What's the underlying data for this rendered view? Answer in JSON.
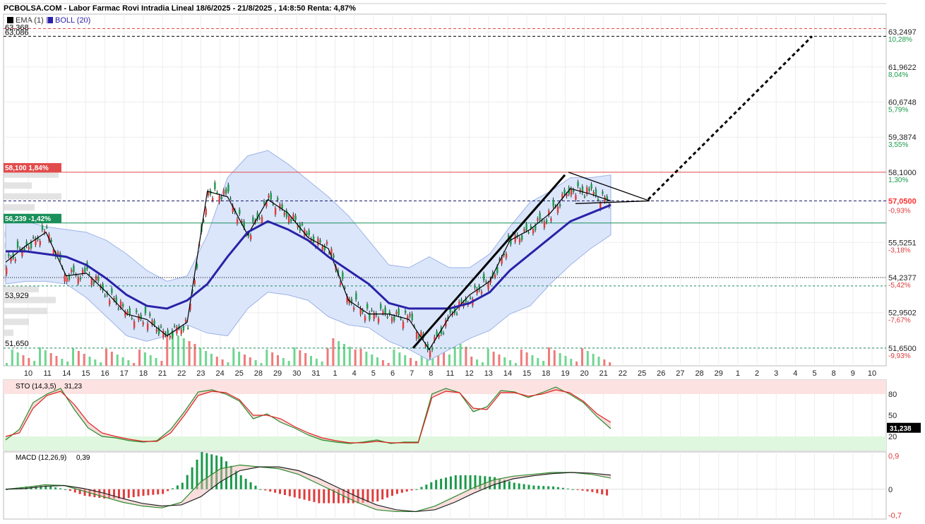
{
  "header": {
    "title": "PCBOLSA.COM - Labor Farmac Rovi Intradia Lineal 18/6/2025 - 21/8/2025 , 14:8:50 Renta: 4,87%",
    "ema_label": "EMA (1)",
    "boll_label": "BOLL (20)"
  },
  "colors": {
    "up": "#1a9a4a",
    "down": "#e03c3c",
    "boll_mid": "#2a22a8",
    "boll_band": "#dbe6fb",
    "boll_band_stroke": "#9db3e6",
    "resistance": "#e24b4b",
    "support": "#1a8f5a",
    "price_tag": "#ff4d4d",
    "volume_up": "#6fd690",
    "volume_down": "#f07a7a",
    "sto_k": "#e02020",
    "sto_d": "#2a8a2a",
    "macd_line": "#222222",
    "macd_signal": "#2a8a2a"
  },
  "chart_data": [
    {
      "type": "line",
      "title": "Labor Farmac Rovi Intradia Lineal 18/6/2025 - 21/8/2025",
      "x": [
        "10",
        "11",
        "14",
        "15",
        "16",
        "17",
        "18",
        "21",
        "22",
        "23",
        "24",
        "25",
        "28",
        "29",
        "30",
        "31",
        "1",
        "4",
        "5",
        "6",
        "7",
        "8",
        "11",
        "12",
        "13",
        "14",
        "15",
        "18",
        "19",
        "20",
        "21",
        "22",
        "25",
        "26",
        "27",
        "28",
        "29",
        "1",
        "2",
        "3",
        "4",
        "5",
        "8",
        "9",
        "10"
      ],
      "series": [
        {
          "name": "EMA (1)",
          "values": [
            54.8,
            55.4,
            55.9,
            54.3,
            54.4,
            53.7,
            52.9,
            52.7,
            52.1,
            52.6,
            57.4,
            57.2,
            55.8,
            57.1,
            56.6,
            55.7,
            55.3,
            53.4,
            52.9,
            52.9,
            52.7,
            51.6,
            52.8,
            53.6,
            54.1,
            55.6,
            56.0,
            56.6,
            57.5,
            57.3,
            57.05
          ]
        },
        {
          "name": "BOLL (20)",
          "values": [
            55.2,
            55.2,
            55.1,
            55.0,
            54.7,
            54.2,
            53.6,
            53.2,
            53.1,
            53.4,
            54.0,
            55.0,
            55.9,
            56.3,
            56.0,
            55.6,
            55.0,
            54.5,
            54.0,
            53.3,
            53.1,
            53.1,
            53.1,
            53.3,
            53.7,
            54.5,
            55.1,
            55.7,
            56.3,
            56.6,
            56.9
          ]
        }
      ],
      "y_ticks": [
        {
          "value": "63,2497",
          "pct": "10,28%"
        },
        {
          "value": "61,9622",
          "pct": "8,04%"
        },
        {
          "value": "60,6748",
          "pct": "5,79%"
        },
        {
          "value": "59,3874",
          "pct": "3,55%"
        },
        {
          "value": "58,1000",
          "pct": "1,30%"
        },
        {
          "value": "55,5251",
          "pct": "-3,18%"
        },
        {
          "value": "54,2377",
          "pct": "-5,42%"
        },
        {
          "value": "52,9502",
          "pct": "-7,67%"
        },
        {
          "value": "51,6500",
          "pct": "-9,93%"
        }
      ],
      "ylim": [
        51.0,
        63.9
      ],
      "last_price": "57,0500",
      "last_pct": "-0,93%",
      "levels": [
        {
          "name": "resistance",
          "value": 58.1,
          "label": "58,100  1,84%"
        },
        {
          "name": "support",
          "value": 56.239,
          "label": "56,239  -1,42%"
        },
        {
          "name": "top-dashed",
          "value": 63.086,
          "label": "63,086"
        },
        {
          "name": "top-max",
          "value": 63.368,
          "label": "63,368"
        },
        {
          "name": "low-dotted",
          "value": 53.929,
          "label": "53,929"
        },
        {
          "name": "min",
          "value": 51.65,
          "label": "51,650"
        }
      ],
      "grid": true
    },
    {
      "type": "line",
      "title": "STO (14,3,5)",
      "last_value": "31,23",
      "tag": "31,238",
      "y_ticks": [
        "80",
        "50",
        "20"
      ],
      "ylim": [
        0,
        100
      ],
      "series": [
        {
          "name": "K",
          "values": [
            15,
            30,
            68,
            80,
            88,
            58,
            32,
            20,
            18,
            14,
            12,
            14,
            30,
            55,
            83,
            86,
            80,
            70,
            45,
            52,
            40,
            32,
            22,
            15,
            12,
            10,
            12,
            15,
            10,
            12,
            12,
            80,
            88,
            82,
            55,
            62,
            85,
            83,
            75,
            82,
            90,
            80,
            68,
            48,
            31
          ]
        },
        {
          "name": "D",
          "values": [
            20,
            25,
            60,
            78,
            84,
            65,
            40,
            25,
            20,
            16,
            13,
            13,
            25,
            50,
            78,
            84,
            82,
            72,
            50,
            50,
            45,
            34,
            25,
            18,
            14,
            11,
            11,
            13,
            11,
            11,
            11,
            75,
            84,
            82,
            60,
            58,
            82,
            82,
            77,
            80,
            86,
            82,
            70,
            52,
            40
          ]
        }
      ]
    },
    {
      "type": "bar",
      "title": "MACD (12,26,9)",
      "last_value": "0,39",
      "y_ticks": [
        "0,9",
        "0",
        "-0,7"
      ],
      "ylim": [
        -0.8,
        1.0
      ],
      "series": [
        {
          "name": "MACD",
          "values": [
            0.0,
            0.05,
            0.12,
            0.1,
            -0.05,
            -0.2,
            -0.35,
            -0.45,
            -0.5,
            -0.35,
            0.2,
            0.55,
            0.65,
            0.6,
            0.55,
            0.4,
            0.15,
            -0.1,
            -0.35,
            -0.55,
            -0.6,
            -0.6,
            -0.45,
            -0.2,
            0.05,
            0.25,
            0.35,
            0.4,
            0.45,
            0.45,
            0.4,
            0.3
          ]
        },
        {
          "name": "Signal",
          "values": [
            0.0,
            0.02,
            0.08,
            0.1,
            0.02,
            -0.1,
            -0.25,
            -0.38,
            -0.45,
            -0.42,
            -0.2,
            0.2,
            0.5,
            0.6,
            0.6,
            0.5,
            0.3,
            0.05,
            -0.2,
            -0.42,
            -0.55,
            -0.6,
            -0.55,
            -0.35,
            -0.1,
            0.12,
            0.28,
            0.36,
            0.42,
            0.45,
            0.43,
            0.38
          ]
        }
      ]
    }
  ]
}
